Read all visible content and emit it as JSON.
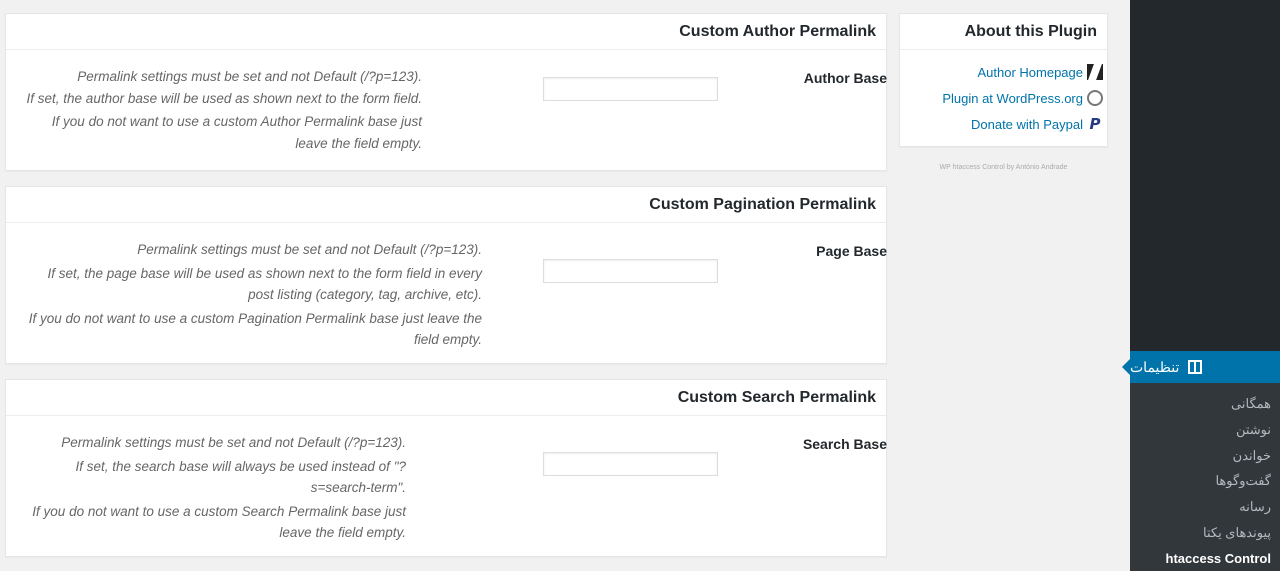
{
  "sidebar": {
    "active_menu": "تنظیمات",
    "submenu": [
      "همگانی",
      "نوشتن",
      "خواندن",
      "گفت‌وگوها",
      "رسانه",
      "پیوندهای یکتا",
      "htaccess Control"
    ],
    "current_submenu": "htaccess Control"
  },
  "about": {
    "title": "About this Plugin",
    "links": [
      "Author Homepage",
      "Plugin at WordPress.org",
      "Donate with Paypal"
    ],
    "credit": "WP htaccess Control by António Andrade"
  },
  "author_box": {
    "title": "Custom Author Permalink",
    "label": "Author Base",
    "input_value": "",
    "desc_lines": [
      "Permalink settings must be set and not Default (/?p=123).",
      "If set, the author base will be used as shown next to the form field.",
      "If you do not want to use a custom Author Permalink base just",
      "leave the field empty."
    ]
  },
  "pagination_box": {
    "title": "Custom Pagination Permalink",
    "label": "Page Base",
    "input_value": "",
    "desc_lines": [
      "Permalink settings must be set and not Default (/?p=123).",
      "If set, the page base will be used as shown next to the form field in every",
      "post listing (category, tag, archive, etc).",
      "If you do not want to use a custom Pagination Permalink base just leave the",
      "field empty."
    ]
  },
  "search_box": {
    "title": "Custom Search Permalink",
    "label": "Search Base",
    "input_value": "",
    "desc_lines": [
      "Permalink settings must be set and not Default (/?p=123).",
      "If set, the search base will always be used instead of \"?",
      "s=search-term\".",
      "If you do not want to use a custom Search Permalink base just",
      "leave the field empty."
    ]
  }
}
